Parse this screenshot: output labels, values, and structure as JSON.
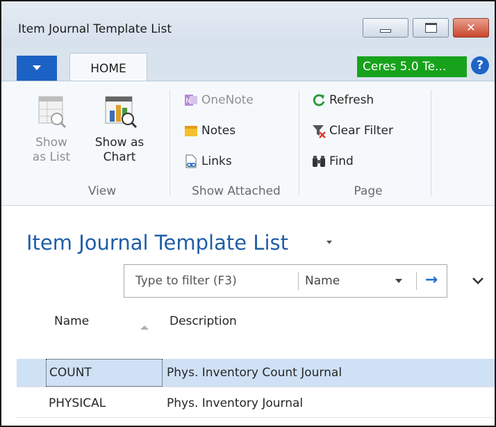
{
  "window": {
    "title": "Item Journal Template List",
    "close_glyph": "✕"
  },
  "tabs": {
    "home": "HOME",
    "company": "Ceres 5.0 Te...",
    "help": "?"
  },
  "ribbon": {
    "view_group": {
      "name": "View",
      "show_as_list": "Show as List",
      "show_as_chart": "Show as Chart"
    },
    "attached_group": {
      "name": "Show Attached",
      "onenote": "OneNote",
      "notes": "Notes",
      "links": "Links"
    },
    "page_group": {
      "name": "Page",
      "refresh": "Refresh",
      "clear_filter": "Clear Filter",
      "find": "Find"
    }
  },
  "page": {
    "title": "Item Journal Template List",
    "filter": {
      "placeholder": "Type to filter (F3)",
      "field": "Name"
    },
    "columns": [
      "Name",
      "Description"
    ],
    "rows": [
      {
        "name": "COUNT",
        "description": "Phys. Inventory Count Journal",
        "selected": true
      },
      {
        "name": "PHYSICAL",
        "description": "Phys. Inventory Journal",
        "selected": false
      }
    ]
  },
  "colors": {
    "accent": "#1b62c4",
    "company_badge": "#17a21c",
    "title": "#1f5ea8",
    "selection": "#cfe1f5"
  },
  "icons": [
    "dropdown-caret-icon",
    "help-icon",
    "show-as-list-icon",
    "show-as-chart-icon",
    "onenote-icon",
    "notes-icon",
    "links-icon",
    "refresh-icon",
    "clear-filter-icon",
    "find-icon",
    "arrow-right-icon",
    "chevron-down-icon",
    "sort-ascending-icon"
  ]
}
